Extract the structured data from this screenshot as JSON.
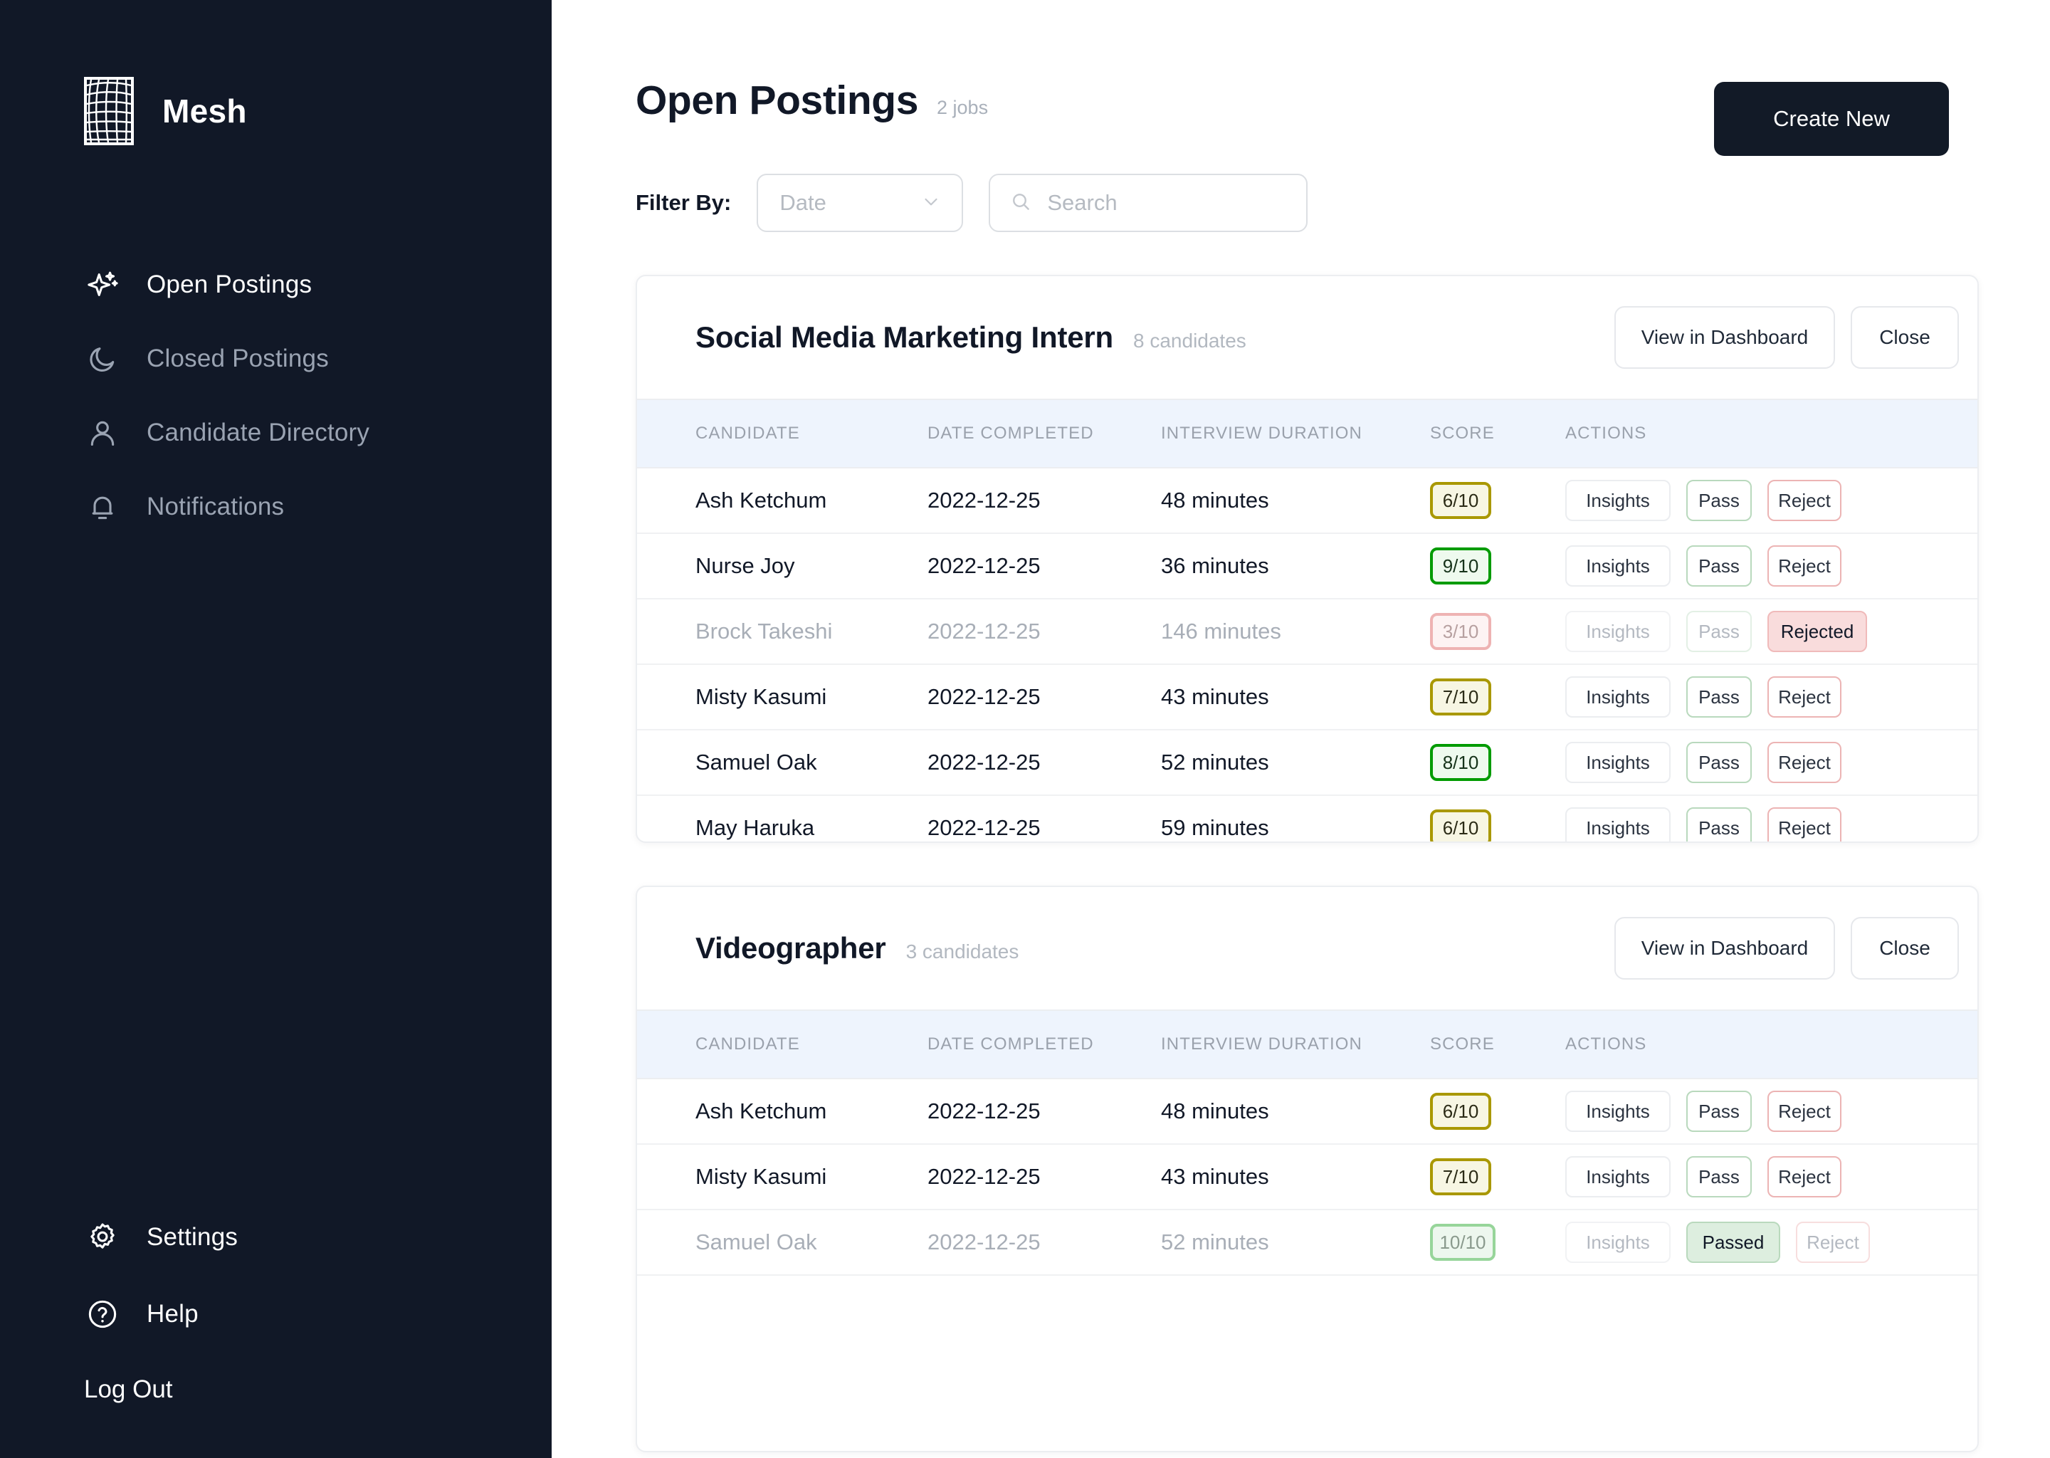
{
  "brand": {
    "name": "Mesh",
    "logo_icon": "mesh-grid-icon"
  },
  "sidebar": {
    "items": [
      {
        "label": "Open Postings",
        "icon": "sparkle-icon",
        "active": true
      },
      {
        "label": "Closed Postings",
        "icon": "moon-icon",
        "active": false
      },
      {
        "label": "Candidate Directory",
        "icon": "user-icon",
        "active": false
      },
      {
        "label": "Notifications",
        "icon": "bell-icon",
        "active": false
      }
    ],
    "bottom_items": [
      {
        "label": "Settings",
        "icon": "gear-icon"
      },
      {
        "label": "Help",
        "icon": "question-circle-icon"
      }
    ],
    "logout_label": "Log Out"
  },
  "header": {
    "title": "Open Postings",
    "job_count": "2 jobs",
    "create_button": "Create New"
  },
  "filters": {
    "label": "Filter By:",
    "select": {
      "value": "Date",
      "icon": "chevron-down-icon"
    },
    "search": {
      "placeholder": "Search",
      "value": "",
      "icon": "search-icon"
    }
  },
  "table_columns": [
    "CANDIDATE",
    "DATE COMPLETED",
    "INTERVIEW DURATION",
    "SCORE",
    "ACTIONS"
  ],
  "colors": {
    "sidebar_bg": "#111827",
    "accent_dark": "#121a27",
    "table_header_bg": "#eef4fd",
    "score_green_border": "#009b00",
    "score_yellow_border": "#a99800",
    "score_red_border": "#eeb3b3",
    "pass_border": "#b9d9bd",
    "reject_border": "#ecb4b4",
    "rejected_fill": "#f9dcdc",
    "passed_fill": "#ddeedf"
  },
  "cards": [
    {
      "title": "Social Media Marketing Intern",
      "subtitle": "8 candidates",
      "view_button": "View in Dashboard",
      "close_button": "Close",
      "rows": [
        {
          "candidate": "Ash Ketchum",
          "date": "2022-12-25",
          "duration": "48 minutes",
          "score": "6/10",
          "score_tone": "yellow",
          "state": "active",
          "actions": {
            "insights": "Insights",
            "pass": "Pass",
            "reject": "Reject"
          }
        },
        {
          "candidate": "Nurse Joy",
          "date": "2022-12-25",
          "duration": "36 minutes",
          "score": "9/10",
          "score_tone": "green",
          "state": "active",
          "actions": {
            "insights": "Insights",
            "pass": "Pass",
            "reject": "Reject"
          }
        },
        {
          "candidate": "Brock Takeshi",
          "date": "2022-12-25",
          "duration": "146 minutes",
          "score": "3/10",
          "score_tone": "red",
          "state": "rejected",
          "actions": {
            "insights": "Insights",
            "pass": "Pass",
            "reject": "Rejected"
          }
        },
        {
          "candidate": "Misty Kasumi",
          "date": "2022-12-25",
          "duration": "43 minutes",
          "score": "7/10",
          "score_tone": "yellow",
          "state": "active",
          "actions": {
            "insights": "Insights",
            "pass": "Pass",
            "reject": "Reject"
          }
        },
        {
          "candidate": "Samuel Oak",
          "date": "2022-12-25",
          "duration": "52 minutes",
          "score": "8/10",
          "score_tone": "green",
          "state": "active",
          "actions": {
            "insights": "Insights",
            "pass": "Pass",
            "reject": "Reject"
          }
        },
        {
          "candidate": "May Haruka",
          "date": "2022-12-25",
          "duration": "59 minutes",
          "score": "6/10",
          "score_tone": "yellow",
          "state": "active",
          "actions": {
            "insights": "Insights",
            "pass": "Pass",
            "reject": "Reject"
          }
        }
      ]
    },
    {
      "title": "Videographer",
      "subtitle": "3 candidates",
      "view_button": "View in Dashboard",
      "close_button": "Close",
      "rows": [
        {
          "candidate": "Ash Ketchum",
          "date": "2022-12-25",
          "duration": "48 minutes",
          "score": "6/10",
          "score_tone": "yellow",
          "state": "active",
          "actions": {
            "insights": "Insights",
            "pass": "Pass",
            "reject": "Reject"
          }
        },
        {
          "candidate": "Misty Kasumi",
          "date": "2022-12-25",
          "duration": "43 minutes",
          "score": "7/10",
          "score_tone": "yellow",
          "state": "active",
          "actions": {
            "insights": "Insights",
            "pass": "Pass",
            "reject": "Reject"
          }
        },
        {
          "candidate": "Samuel Oak",
          "date": "2022-12-25",
          "duration": "52 minutes",
          "score": "10/10",
          "score_tone": "green-soft",
          "state": "passed",
          "actions": {
            "insights": "Insights",
            "pass": "Passed",
            "reject": "Reject"
          }
        }
      ]
    }
  ]
}
